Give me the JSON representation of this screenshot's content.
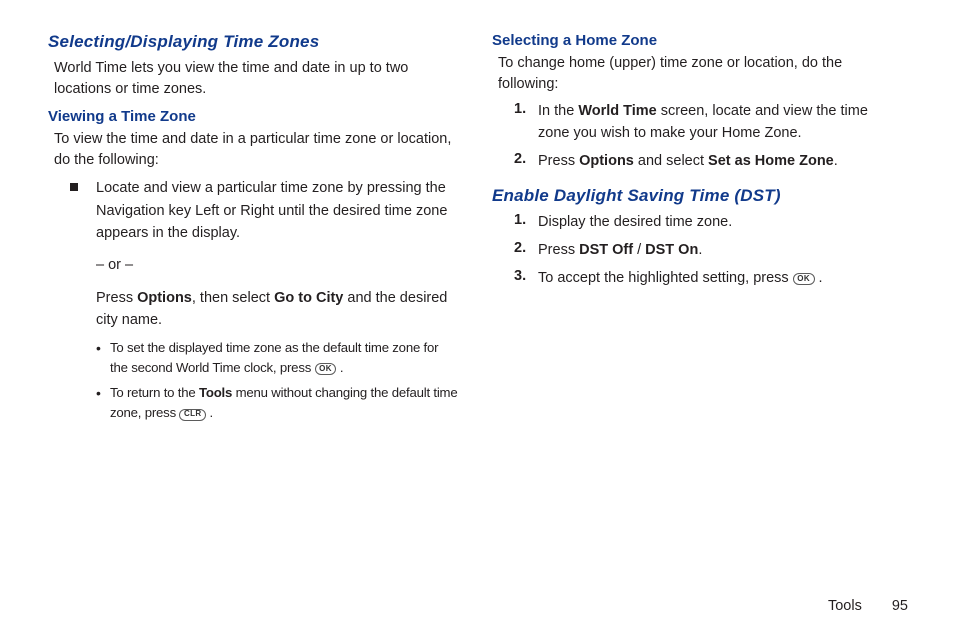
{
  "left": {
    "heading": "Selecting/Displaying Time Zones",
    "intro": "World Time lets you view the time and date in up to two locations or time zones.",
    "sub_viewing": "Viewing a Time Zone",
    "viewing_intro": "To view the time and date in a particular time zone or location, do the following:",
    "sq1_pre": "Locate and view a particular time zone by pressing the Navigation key Left or Right until the desired time zone appears in the display.",
    "or": "– or –",
    "sq1_post_a": "Press ",
    "sq1_post_b": "Options",
    "sq1_post_c": ", then select ",
    "sq1_post_d": "Go to City",
    "sq1_post_e": " and the desired city name.",
    "bl1_a": "To set the displayed time zone as the default time zone for the second World Time clock, press ",
    "bl1_key": "OK",
    "bl1_b": " .",
    "bl2_a": "To return to the ",
    "bl2_b": "Tools",
    "bl2_c": " menu without changing the default time zone, press ",
    "bl2_key": "CLR",
    "bl2_d": " ."
  },
  "right": {
    "sub_home": "Selecting a Home Zone",
    "home_intro": "To change home (upper) time zone or location, do the following:",
    "h1_a": "In the ",
    "h1_b": "World Time",
    "h1_c": " screen, locate and view the time zone you wish to make your Home Zone.",
    "h2_a": "Press ",
    "h2_b": "Options",
    "h2_c": " and select ",
    "h2_d": "Set as Home Zone",
    "h2_e": ".",
    "heading_dst": "Enable Daylight Saving Time (DST)",
    "d1": "Display the desired time zone.",
    "d2_a": "Press ",
    "d2_b": "DST Off",
    "d2_c": " / ",
    "d2_d": "DST On",
    "d2_e": ".",
    "d3_a": "To accept the highlighted setting, press ",
    "d3_key": "OK",
    "d3_b": " ."
  },
  "footer": {
    "section": "Tools",
    "page": "95"
  },
  "nums": {
    "n1": "1.",
    "n2": "2.",
    "n3": "3."
  },
  "dot": "•"
}
